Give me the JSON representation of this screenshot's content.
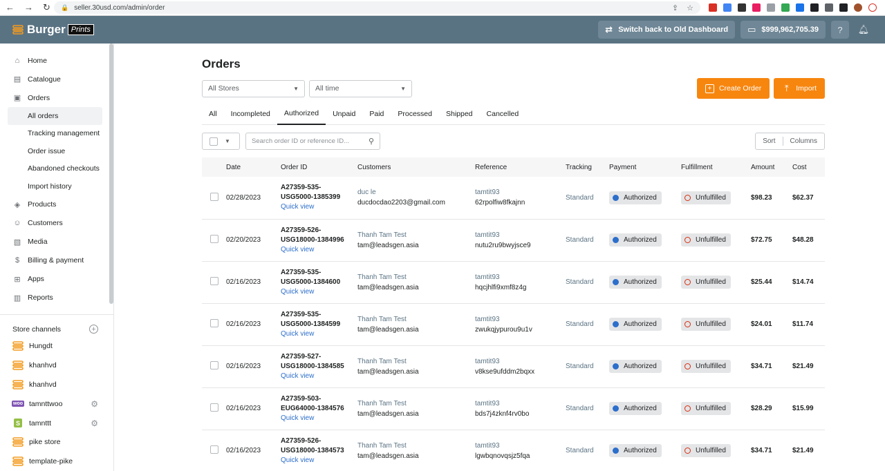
{
  "browser": {
    "url": "seller.30usd.com/admin/order"
  },
  "header": {
    "logo_text": "Burger",
    "logo_sub": "Prints",
    "switch_label": "Switch back to Old Dashboard",
    "balance": "$999,962,705.39"
  },
  "sidebar": {
    "items": [
      {
        "label": "Home",
        "icon": "home-icon"
      },
      {
        "label": "Catalogue",
        "icon": "catalogue-icon"
      },
      {
        "label": "Orders",
        "icon": "orders-icon"
      }
    ],
    "order_sub": [
      "All orders",
      "Tracking management",
      "Order issue",
      "Abandoned checkouts",
      "Import history"
    ],
    "items2": [
      {
        "label": "Products",
        "icon": "products-icon"
      },
      {
        "label": "Customers",
        "icon": "customers-icon"
      },
      {
        "label": "Media",
        "icon": "media-icon"
      },
      {
        "label": "Billing & payment",
        "icon": "billing-icon"
      },
      {
        "label": "Apps",
        "icon": "apps-icon"
      },
      {
        "label": "Reports",
        "icon": "reports-icon"
      }
    ],
    "store_channels_label": "Store channels",
    "channels": [
      {
        "name": "Hungdt",
        "type": "burger"
      },
      {
        "name": "khanhvd",
        "type": "burger"
      },
      {
        "name": "khanhvd",
        "type": "burger"
      },
      {
        "name": "tamnttwoo",
        "type": "woo"
      },
      {
        "name": "tamnttt",
        "type": "shopify"
      },
      {
        "name": "pike store",
        "type": "burger"
      },
      {
        "name": "template-pike",
        "type": "burger"
      }
    ]
  },
  "main": {
    "title": "Orders",
    "store_filter": "All Stores",
    "time_filter": "All time",
    "create_label": "Create Order",
    "import_label": "Import",
    "tabs": [
      "All",
      "Incompleted",
      "Authorized",
      "Unpaid",
      "Paid",
      "Processed",
      "Shipped",
      "Cancelled"
    ],
    "active_tab": "Authorized",
    "search_placeholder": "Search order ID or reference ID...",
    "sort_label": "Sort",
    "columns_label": "Columns",
    "columns": [
      "Date",
      "Order ID",
      "Customers",
      "Reference",
      "Tracking",
      "Payment",
      "Fulfillment",
      "Amount",
      "Cost"
    ],
    "quick_view_label": "Quick view",
    "rows": [
      {
        "date": "02/28/2023",
        "id1": "A27359-535-",
        "id2": "USG5000-1385399",
        "cust": "duc le",
        "email": "ducdocdao2203@gmail.com",
        "ref1": "tamtit93",
        "ref2": "62rpolfiw8fkajnn",
        "tracking": "Standard",
        "payment": "Authorized",
        "fulfillment": "Unfulfilled",
        "amount": "$98.23",
        "cost": "$62.37"
      },
      {
        "date": "02/20/2023",
        "id1": "A27359-526-",
        "id2": "USG18000-1384996",
        "cust": "Thanh Tam Test",
        "email": "tam@leadsgen.asia",
        "ref1": "tamtit93",
        "ref2": "nutu2ru9bwyjsce9",
        "tracking": "Standard",
        "payment": "Authorized",
        "fulfillment": "Unfulfilled",
        "amount": "$72.75",
        "cost": "$48.28"
      },
      {
        "date": "02/16/2023",
        "id1": "A27359-535-",
        "id2": "USG5000-1384600",
        "cust": "Thanh Tam Test",
        "email": "tam@leadsgen.asia",
        "ref1": "tamtit93",
        "ref2": "hqcjhlfi9xmf8z4g",
        "tracking": "Standard",
        "payment": "Authorized",
        "fulfillment": "Unfulfilled",
        "amount": "$25.44",
        "cost": "$14.74"
      },
      {
        "date": "02/16/2023",
        "id1": "A27359-535-",
        "id2": "USG5000-1384599",
        "cust": "Thanh Tam Test",
        "email": "tam@leadsgen.asia",
        "ref1": "tamtit93",
        "ref2": "zwukqjypurou9u1v",
        "tracking": "Standard",
        "payment": "Authorized",
        "fulfillment": "Unfulfilled",
        "amount": "$24.01",
        "cost": "$11.74"
      },
      {
        "date": "02/16/2023",
        "id1": "A27359-527-",
        "id2": "USG18000-1384585",
        "cust": "Thanh Tam Test",
        "email": "tam@leadsgen.asia",
        "ref1": "tamtit93",
        "ref2": "v8kse9ufddm2bqxx",
        "tracking": "Standard",
        "payment": "Authorized",
        "fulfillment": "Unfulfilled",
        "amount": "$34.71",
        "cost": "$21.49"
      },
      {
        "date": "02/16/2023",
        "id1": "A27359-503-",
        "id2": "EUG64000-1384576",
        "cust": "Thanh Tam Test",
        "email": "tam@leadsgen.asia",
        "ref1": "tamtit93",
        "ref2": "bds7j4zknf4rv0bo",
        "tracking": "Standard",
        "payment": "Authorized",
        "fulfillment": "Unfulfilled",
        "amount": "$28.29",
        "cost": "$15.99"
      },
      {
        "date": "02/16/2023",
        "id1": "A27359-526-",
        "id2": "USG18000-1384573",
        "cust": "Thanh Tam Test",
        "email": "tam@leadsgen.asia",
        "ref1": "tamtit93",
        "ref2": "lgwbqnovqsjz5fqa",
        "tracking": "Standard",
        "payment": "Authorized",
        "fulfillment": "Unfulfilled",
        "amount": "$34.71",
        "cost": "$21.49"
      }
    ]
  },
  "colors": {
    "header_bg": "#5a7383",
    "accent": "#f7860f",
    "link": "#2c6ecb",
    "danger": "#d72c0d"
  }
}
